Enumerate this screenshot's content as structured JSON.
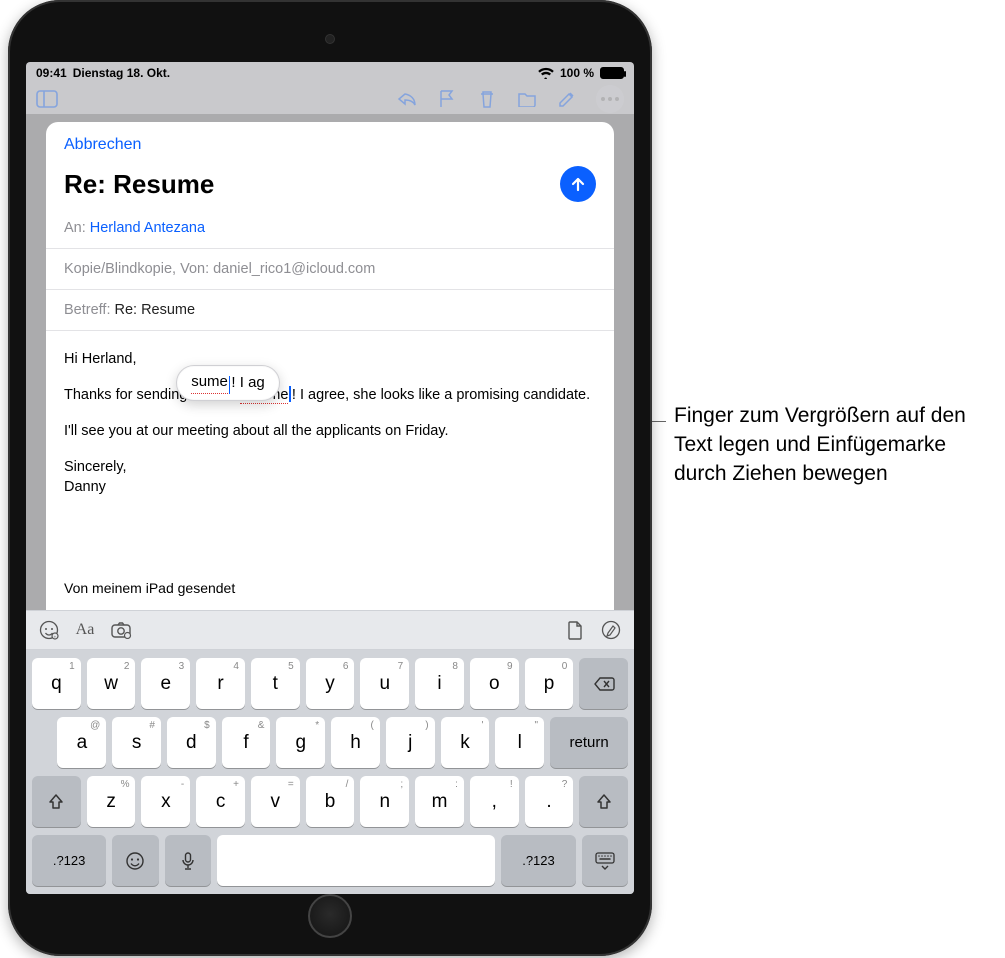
{
  "statusbar": {
    "time": "09:41",
    "date": "Dienstag 18. Okt.",
    "wifi_label": "wifi-icon",
    "battery_percent": "100 %"
  },
  "toolbar_behind": {
    "sidebar_icon": "sidebar-icon",
    "reply_icon": "reply-icon",
    "flag_icon": "flag-icon",
    "trash_icon": "trash-icon",
    "folder_icon": "folder-icon",
    "compose_icon": "compose-icon",
    "more_icon": "more-ellipsis-icon"
  },
  "compose": {
    "cancel": "Abbrechen",
    "title": "Re: Resume",
    "send_label": "send-arrow-up-icon",
    "to_label": "An:",
    "to_name": "Herland Antezana",
    "ccbcc_label": "Kopie/Blindkopie, Von:",
    "ccbcc_value": "daniel_rico1@icloud.com",
    "subject_label": "Betreff:",
    "subject_value": "Re: Resume",
    "body": {
      "greeting": "Hi Herland,",
      "line1_pre": "Thanks for sending Carol's ",
      "line1_misspell": "résume",
      "line1_post": "! I agree, she looks like a promising candidate.",
      "line2": "I'll see you at our meeting about all the applicants on Friday.",
      "sig1": "Sincerely,",
      "sig2": "Danny",
      "sent_from": "Von meinem iPad gesendet"
    },
    "loupe": {
      "pre": "sume",
      "post": "! I ag"
    }
  },
  "keyboard": {
    "accessory": {
      "emoji_lang": "globe-emoji-icon",
      "format": "Aa",
      "camera": "camera-scan-icon",
      "doc": "document-icon",
      "markup": "markup-pen-icon"
    },
    "row1": [
      {
        "main": "q",
        "hint": "1"
      },
      {
        "main": "w",
        "hint": "2"
      },
      {
        "main": "e",
        "hint": "3"
      },
      {
        "main": "r",
        "hint": "4"
      },
      {
        "main": "t",
        "hint": "5"
      },
      {
        "main": "y",
        "hint": "6"
      },
      {
        "main": "u",
        "hint": "7"
      },
      {
        "main": "i",
        "hint": "8"
      },
      {
        "main": "o",
        "hint": "9"
      },
      {
        "main": "p",
        "hint": "0"
      }
    ],
    "row2": [
      {
        "main": "a",
        "hint": "@"
      },
      {
        "main": "s",
        "hint": "#"
      },
      {
        "main": "d",
        "hint": "$"
      },
      {
        "main": "f",
        "hint": "&"
      },
      {
        "main": "g",
        "hint": "*"
      },
      {
        "main": "h",
        "hint": "("
      },
      {
        "main": "j",
        "hint": ")"
      },
      {
        "main": "k",
        "hint": "'"
      },
      {
        "main": "l",
        "hint": "\""
      }
    ],
    "row3": [
      {
        "main": "z",
        "hint": "%"
      },
      {
        "main": "x",
        "hint": "-"
      },
      {
        "main": "c",
        "hint": "+"
      },
      {
        "main": "v",
        "hint": "="
      },
      {
        "main": "b",
        "hint": "/"
      },
      {
        "main": "n",
        "hint": ";"
      },
      {
        "main": "m",
        "hint": ":"
      }
    ],
    "row3_extra": [
      {
        "main": ",",
        "hint": "!"
      },
      {
        "main": ".",
        "hint": "?"
      }
    ],
    "shift": "shift-icon",
    "backspace": "backspace-icon",
    "return": "return",
    "numsym": ".?123",
    "emoji": "emoji-icon",
    "dictation": "mic-dictation-icon",
    "dismiss": "dismiss-keyboard-icon"
  },
  "annotation": {
    "text": "Finger zum Vergrößern auf den Text legen und Einfügemarke durch Ziehen bewegen"
  }
}
